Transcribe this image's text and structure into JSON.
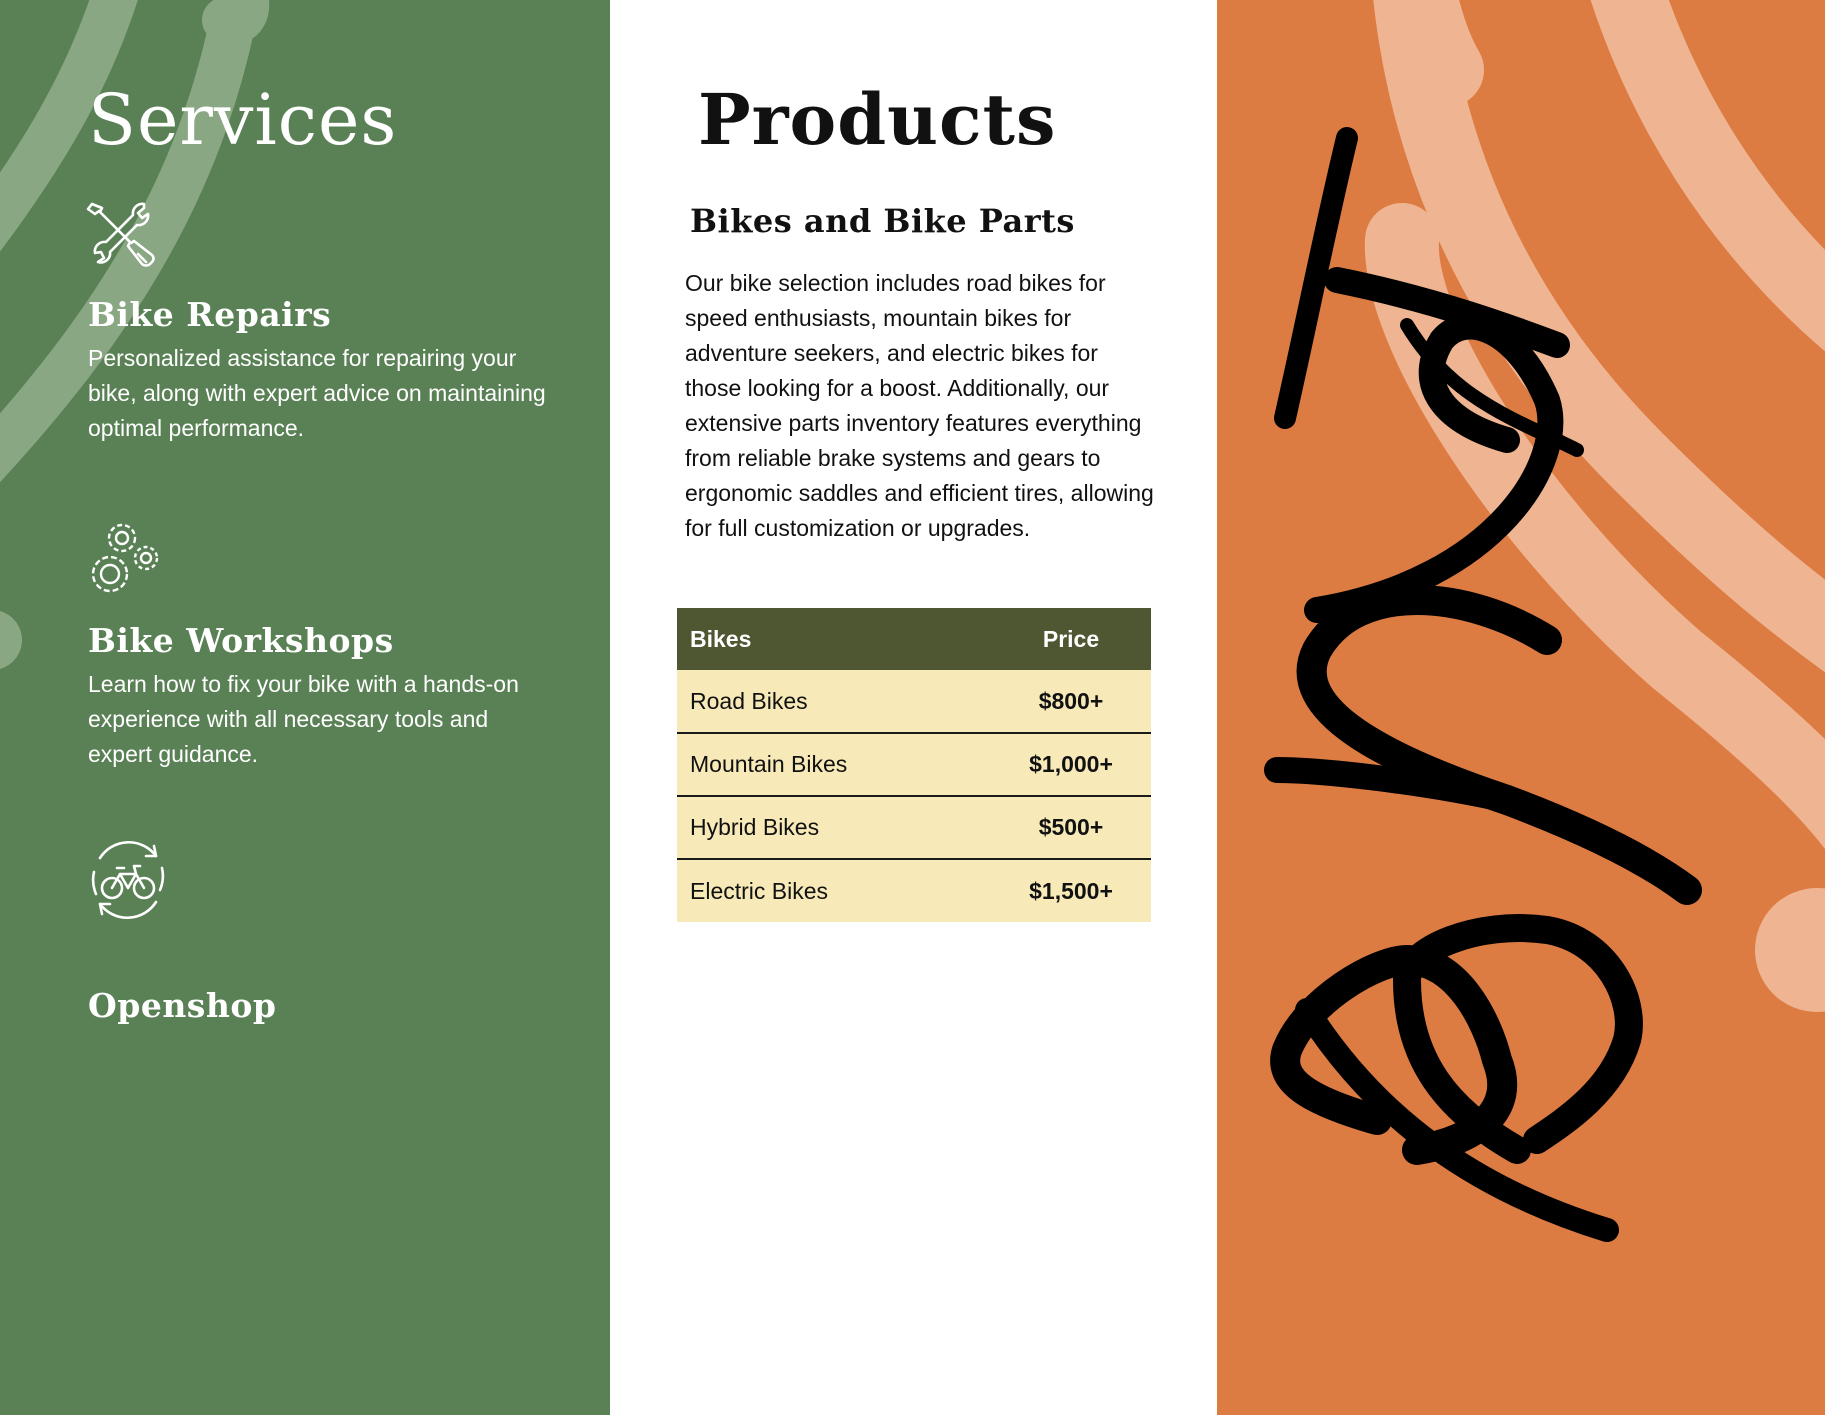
{
  "services": {
    "title": "Services",
    "items": [
      {
        "icon": "wrench-screwdriver-icon",
        "heading": "Bike Repairs",
        "description": "Personalized assistance for repairing your bike, along with expert advice on maintaining optimal performance."
      },
      {
        "icon": "gears-icon",
        "heading": "Bike Workshops",
        "description": "Learn how to fix your bike with a hands-on experience with all necessary tools and expert guidance."
      },
      {
        "icon": "bike-cycle-icon",
        "heading": "Openshop",
        "description": ""
      }
    ]
  },
  "products": {
    "title": "Products",
    "subtitle": "Bikes and Bike Parts",
    "description": "Our bike selection includes road bikes for speed enthusiasts, mountain bikes for adventure seekers, and electric bikes for those looking for a boost. Additionally, our extensive parts inventory features everything from reliable brake systems and gears to ergonomic saddles and efficient tires, allowing for full customization or upgrades.",
    "table": {
      "headers": [
        "Bikes",
        "Price"
      ],
      "rows": [
        [
          "Road Bikes",
          "$800+"
        ],
        [
          "Mountain Bikes",
          "$1,000+"
        ],
        [
          "Hybrid Bikes",
          "$500+"
        ],
        [
          "Electric Bikes",
          "$1,500+"
        ]
      ]
    }
  },
  "brand": {
    "logo_text": "Bunt",
    "icon": "brand-script-logo"
  },
  "colors": {
    "green_panel": "#5a8155",
    "orange_panel": "#dd7c42",
    "table_header": "#4f5632",
    "table_row": "#f7eab8"
  }
}
